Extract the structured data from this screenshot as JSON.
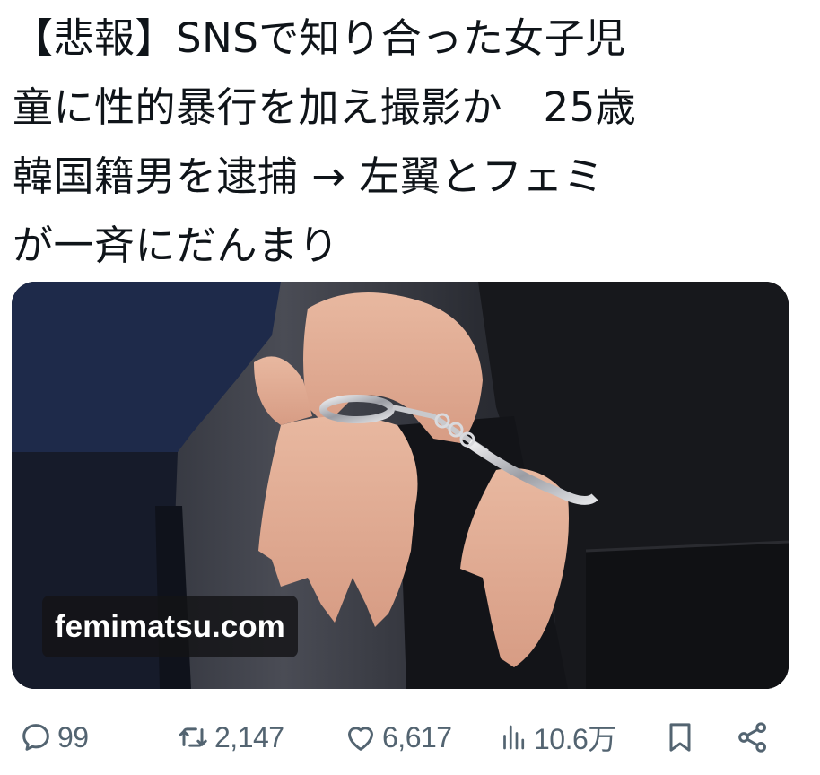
{
  "post": {
    "text_lines": [
      "【悲報】SNSで知り合った女子児",
      "童に性的暴行を加え撮影か　25歳",
      "韓国籍男を逮捕 → 左翼とフェミ",
      "が一斉にだんまり"
    ]
  },
  "media": {
    "watermark": "femimatsu.com",
    "icon": "handcuffed-hands-photo"
  },
  "actions": {
    "reply": {
      "icon": "reply-icon",
      "count": "99"
    },
    "repost": {
      "icon": "repost-icon",
      "count": "2,147"
    },
    "like": {
      "icon": "heart-icon",
      "count": "6,617"
    },
    "views": {
      "icon": "views-icon",
      "count": "10.6万"
    },
    "bookmark": {
      "icon": "bookmark-icon"
    },
    "share": {
      "icon": "share-icon"
    }
  },
  "colors": {
    "text": "#0f1419",
    "secondary": "#536471",
    "background": "#ffffff"
  }
}
